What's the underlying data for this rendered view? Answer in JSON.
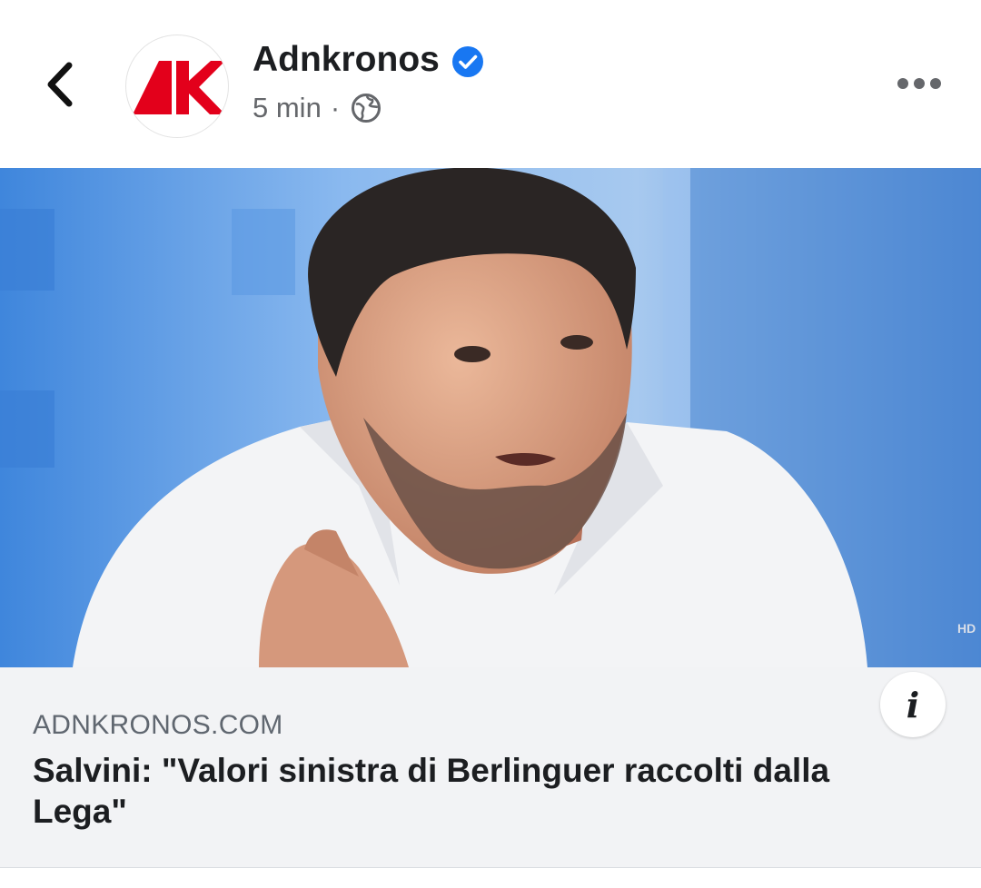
{
  "header": {
    "page_name": "Adnkronos",
    "timestamp": "5 min",
    "separator": "·",
    "verified_icon": "verified-badge-icon",
    "privacy_icon": "globe-icon",
    "back_icon": "chevron-left-icon",
    "more_icon": "more-horizontal-icon",
    "verified_color": "#1877f2",
    "logo_color": "#e3001b"
  },
  "photo": {
    "hd_label": "HD"
  },
  "link_preview": {
    "domain": "ADNKRONOS.COM",
    "headline": "Salvini: \"Valori sinistra di Berlinguer raccolti dalla Lega\"",
    "info_label": "i"
  }
}
